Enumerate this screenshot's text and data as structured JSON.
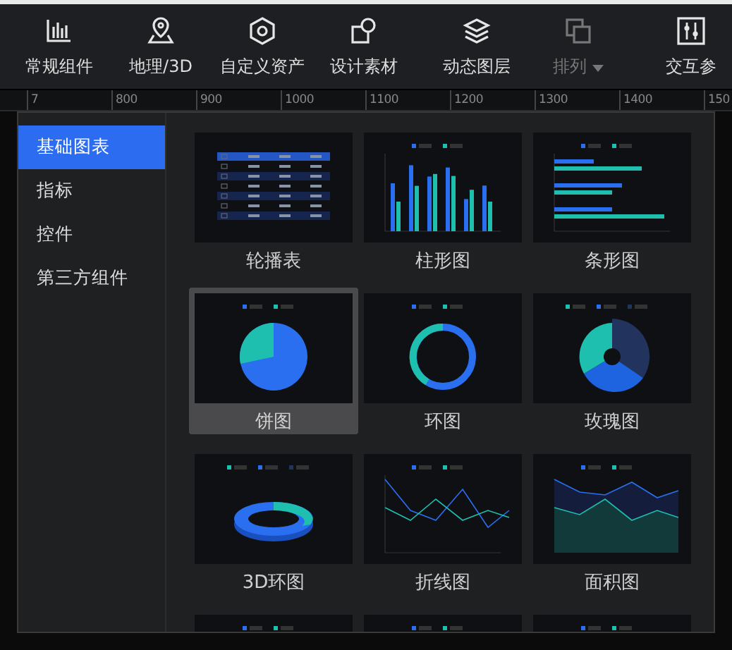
{
  "toolbar": {
    "items": [
      {
        "label": "常规组件",
        "disabled": false,
        "dropdown": false
      },
      {
        "label": "地理/3D",
        "disabled": false,
        "dropdown": false
      },
      {
        "label": "自定义资产",
        "disabled": false,
        "dropdown": false
      },
      {
        "label": "设计素材",
        "disabled": false,
        "dropdown": false
      },
      {
        "label": "动态图层",
        "disabled": false,
        "dropdown": false
      },
      {
        "label": "排列",
        "disabled": true,
        "dropdown": true
      },
      {
        "label": "交互参",
        "disabled": false,
        "dropdown": false
      }
    ]
  },
  "ruler": {
    "labels": [
      "7",
      "800",
      "900",
      "1000",
      "1100",
      "1200",
      "1300",
      "1400",
      "150"
    ]
  },
  "sidebar": {
    "items": [
      {
        "label": "基础图表",
        "selected": true
      },
      {
        "label": "指标",
        "selected": false
      },
      {
        "label": "控件",
        "selected": false
      },
      {
        "label": "第三方组件",
        "selected": false
      }
    ]
  },
  "cards": [
    {
      "label": "轮播表",
      "kind": "table",
      "selected": false
    },
    {
      "label": "柱形图",
      "kind": "bar",
      "selected": false
    },
    {
      "label": "条形图",
      "kind": "hbar",
      "selected": false
    },
    {
      "label": "饼图",
      "kind": "pie",
      "selected": true
    },
    {
      "label": "环图",
      "kind": "ring",
      "selected": false
    },
    {
      "label": "玫瑰图",
      "kind": "rose",
      "selected": false
    },
    {
      "label": "3D环图",
      "kind": "ring3d",
      "selected": false
    },
    {
      "label": "折线图",
      "kind": "line",
      "selected": false
    },
    {
      "label": "面积图",
      "kind": "area",
      "selected": false
    },
    {
      "kind": "cut",
      "selected": false
    },
    {
      "kind": "cut",
      "selected": false
    },
    {
      "kind": "cut",
      "selected": false
    }
  ]
}
